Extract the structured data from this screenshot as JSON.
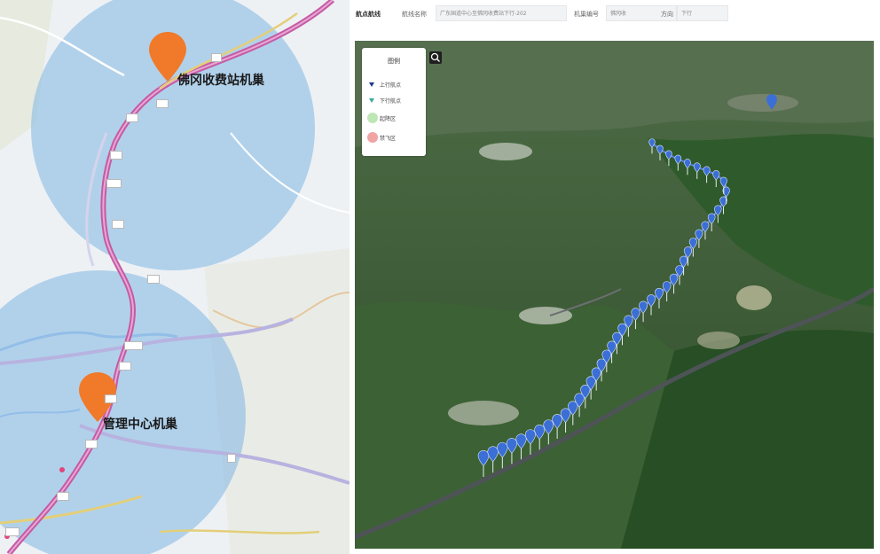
{
  "map2d": {
    "pins": [
      {
        "label": "佛冈收费站机巢"
      },
      {
        "label": "管理中心机巢"
      }
    ],
    "colors": {
      "coverage": "#7fb6e4",
      "pin": "#f07a2a",
      "highway": "#c55aa5",
      "road": "#b7b3e0",
      "yellow_road": "#e3cf7a"
    }
  },
  "panel3d": {
    "toolbar": {
      "title": "航点航线",
      "field1_label": "航线名称",
      "field1_value": "广东国道中心至佛冈收费站下行-202",
      "field2_label": "机巢编号",
      "field2_value": "佛冈收",
      "field3_label": "方向",
      "field3_value": "下行"
    },
    "legend": {
      "title": "图例",
      "items": [
        {
          "label": "上行航点",
          "color": "#1e3a8a"
        },
        {
          "label": "下行航点",
          "color": "#3aa99f"
        },
        {
          "label": "起降区",
          "color": "#bfe6b5"
        },
        {
          "label": "禁飞区",
          "color": "#f0a4a4"
        }
      ]
    },
    "colors": {
      "waypoint": "#3b6fd6",
      "terrain": "#3f6235"
    }
  }
}
